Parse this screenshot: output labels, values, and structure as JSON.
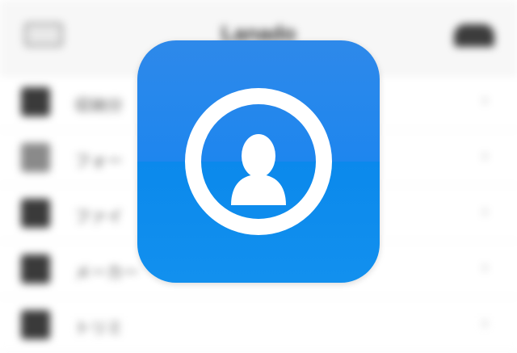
{
  "nav": {
    "title": "Lanado",
    "left_icon": "menu-icon",
    "right_icon": "cloud-icon"
  },
  "list": {
    "items": [
      {
        "label": "収納分",
        "icon": "grid-icon"
      },
      {
        "label": "フォー",
        "icon": "folder-icon"
      },
      {
        "label": "ファイ",
        "icon": "file-icon"
      },
      {
        "label": "メーカー",
        "icon": "box-icon"
      },
      {
        "label": "トリミ",
        "icon": "crop-icon"
      }
    ],
    "chevron": "›"
  },
  "app_icon": {
    "icon": "user-profile-icon",
    "color_top": "#2e89ea",
    "color_bottom": "#0b89ec",
    "glyph_color": "#ffffff"
  }
}
